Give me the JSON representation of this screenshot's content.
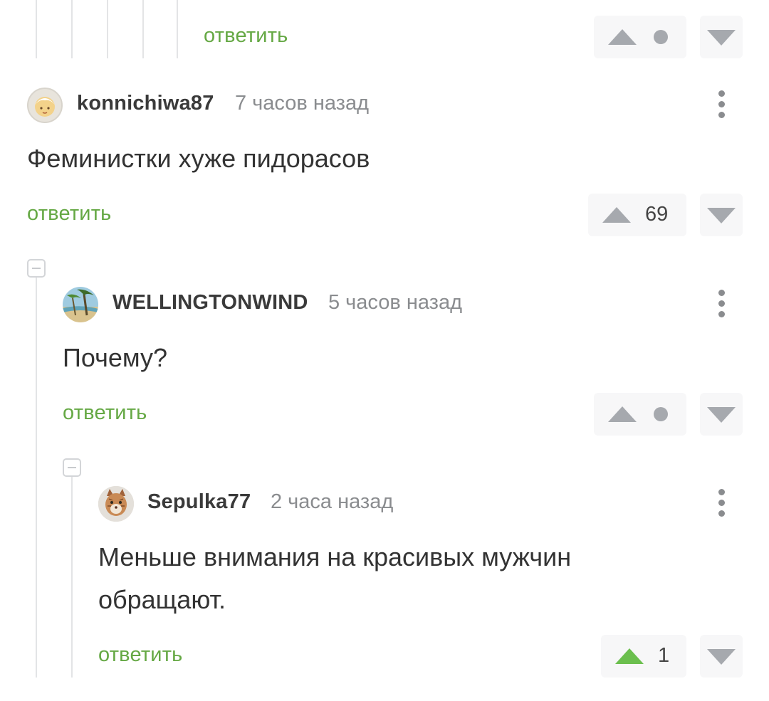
{
  "thread": {
    "top_reply_label": "ответить",
    "comments": [
      {
        "username": "konnichiwa87",
        "time": "7 часов назад",
        "text": "Феминистки хуже пидорасов",
        "reply_label": "ответить",
        "rating": "69"
      },
      {
        "username": "WELLINGTONWIND",
        "time": "5 часов назад",
        "text": "Почему?",
        "reply_label": "ответить",
        "rating": ""
      },
      {
        "username": "Sepulka77",
        "time": "2 часа назад",
        "text_line1": "Меньше внимания на красивых мужчин",
        "text_line2": "обращают.",
        "reply_label": "ответить",
        "rating": "1"
      }
    ]
  },
  "icons": {
    "upvote": "triangle-up-icon",
    "downvote": "triangle-down-icon",
    "more": "kebab-menu-icon",
    "collapse": "minus-box-icon"
  },
  "colors": {
    "reply_green": "#65a844",
    "upvoted_green": "#6bbf4e",
    "vote_gray": "#a6a9ae",
    "vote_bg": "#f7f7f8"
  }
}
